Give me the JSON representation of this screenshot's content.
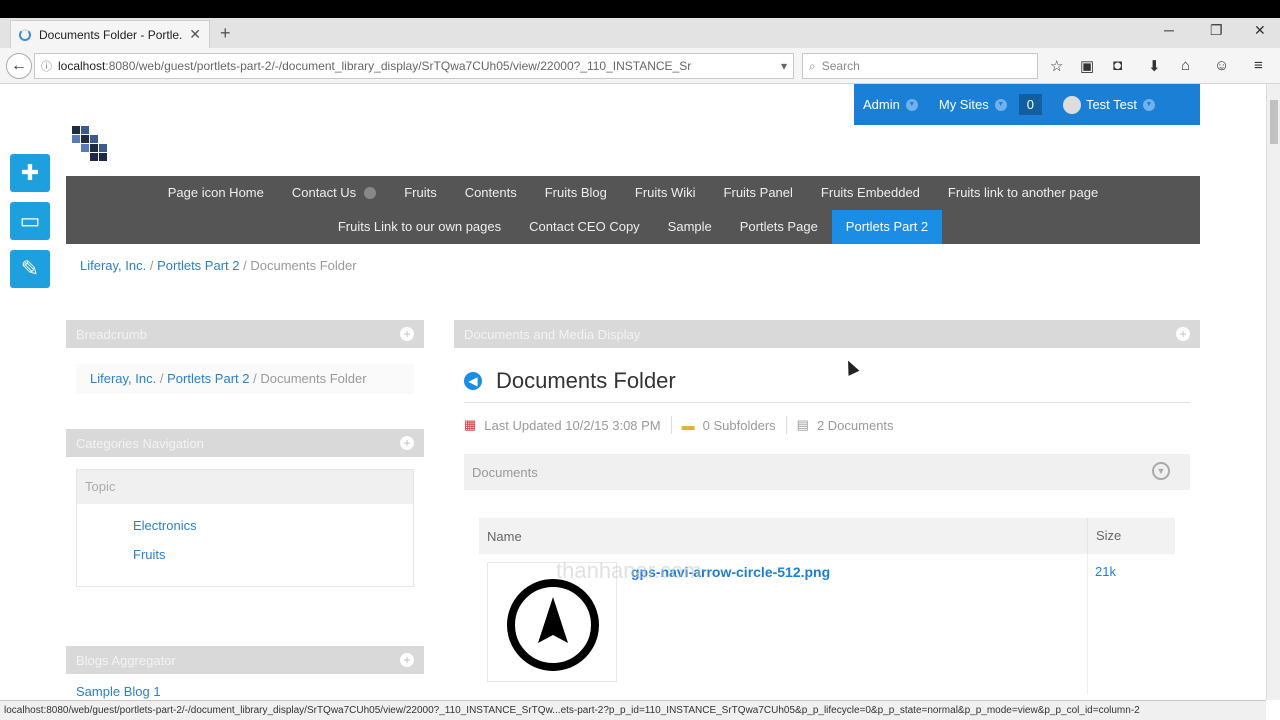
{
  "browser": {
    "tab_title": "Documents Folder - Portle...",
    "new_tab": "+",
    "url_host": "localhost",
    "url_rest": ":8080/web/guest/portlets-part-2/-/document_library_display/SrTQwa7CUh05/view/22000?_110_INSTANCE_Sr",
    "search_placeholder": "Search",
    "status_url": "localhost:8080/web/guest/portlets-part-2/-/document_library_display/SrTQwa7CUh05/view/22000?_110_INSTANCE_SrTQw...ets-part-2?p_p_id=110_INSTANCE_SrTQwa7CUh05&p_p_lifecycle=0&p_p_state=normal&p_p_mode=view&p_p_col_id=column-2"
  },
  "dockbar": {
    "admin": "Admin",
    "my_sites": "My Sites",
    "notifications": "0",
    "user": "Test Test"
  },
  "nav": {
    "row1": [
      "Page icon Home",
      "Contact Us",
      "Fruits",
      "Contents",
      "Fruits Blog",
      "Fruits Wiki",
      "Fruits Panel",
      "Fruits Embedded",
      "Fruits link to another page"
    ],
    "row2": [
      "Fruits Link to our own pages",
      "Contact CEO Copy",
      "Sample",
      "Portlets Page",
      "Portlets Part 2"
    ]
  },
  "breadcrumb": {
    "item1": "Liferay, Inc.",
    "item2": "Portlets Part 2",
    "current": "Documents Folder",
    "sep": "/"
  },
  "left": {
    "breadcrumb_title": "Breadcrumb",
    "categories_title": "Categories Navigation",
    "topic": "Topic",
    "categories": [
      "Electronics",
      "Fruits"
    ],
    "blogs_title": "Blogs Aggregator",
    "blog_entry": "Sample Blog 1"
  },
  "right": {
    "portlet_title": "Documents and Media Display",
    "folder_title": "Documents Folder",
    "last_updated": "Last Updated 10/2/15 3:08 PM",
    "subfolders": "0 Subfolders",
    "documents_count": "2 Documents",
    "panel_title": "Documents",
    "col_name": "Name",
    "col_size": "Size",
    "file_name": "gps-navi-arrow-circle-512.png",
    "file_size": "21k"
  },
  "watermark": "thanhanar.com"
}
